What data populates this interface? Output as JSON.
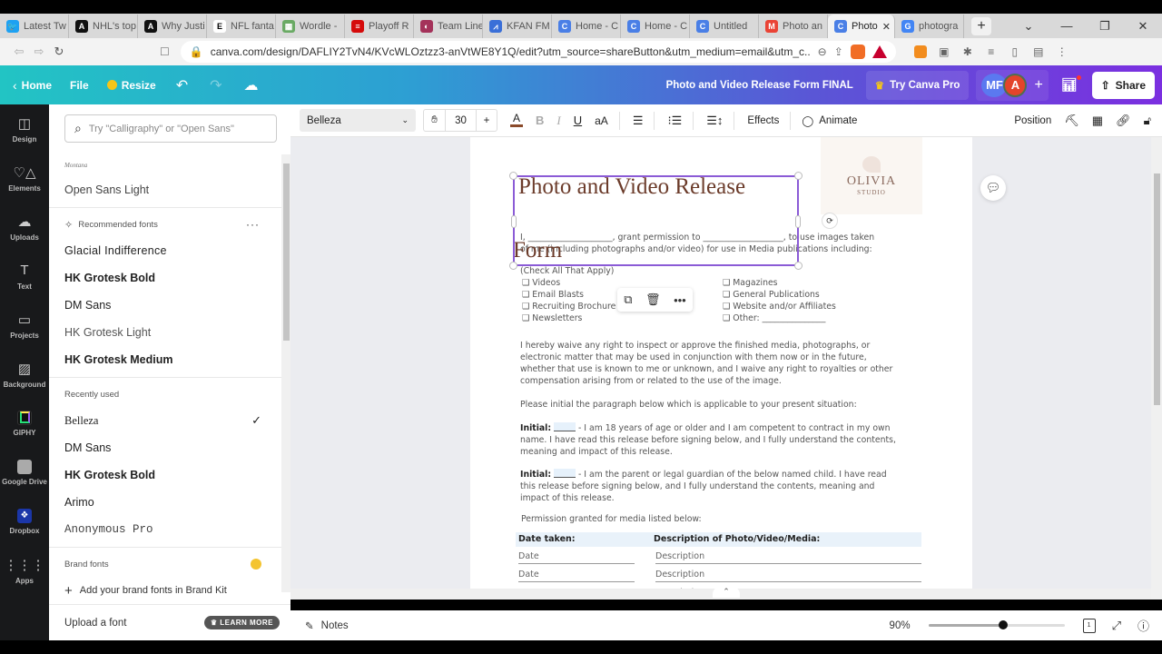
{
  "browser": {
    "tabs": [
      {
        "label": "Latest Tw",
        "icon": "twitter-icon",
        "color": "#1da1f2",
        "glyph": "🐦"
      },
      {
        "label": "NHL's top",
        "icon": "athletic-icon",
        "color": "#111111",
        "glyph": "A"
      },
      {
        "label": "Why Justi",
        "icon": "athletic-icon",
        "color": "#111111",
        "glyph": "A"
      },
      {
        "label": "NFL fanta",
        "icon": "espn-icon",
        "color": "#ffffff",
        "glyph": "E"
      },
      {
        "label": "Wordle -",
        "icon": "wordle-icon",
        "color": "#6aaa64",
        "glyph": "▦"
      },
      {
        "label": "Playoff R",
        "icon": "espn-red-icon",
        "color": "#d50a0a",
        "glyph": "≡"
      },
      {
        "label": "Team Line",
        "icon": "team-icon",
        "color": "#a4325a",
        "glyph": "◐"
      },
      {
        "label": "KFAN FM",
        "icon": "kfan-icon",
        "color": "#3a6fd8",
        "glyph": "⩘"
      },
      {
        "label": "Home - C",
        "icon": "canva-icon",
        "color": "#4a7fe6",
        "glyph": "C"
      },
      {
        "label": "Home - C",
        "icon": "canva-icon",
        "color": "#4a7fe6",
        "glyph": "C"
      },
      {
        "label": "Untitled",
        "icon": "canva-icon",
        "color": "#4a7fe6",
        "glyph": "C"
      },
      {
        "label": "Photo an",
        "icon": "gmail-icon",
        "color": "#ea4335",
        "glyph": "M"
      },
      {
        "label": "Photo",
        "icon": "canva-icon",
        "color": "#4a7fe6",
        "glyph": "C",
        "active": true
      },
      {
        "label": "photogra",
        "icon": "google-icon",
        "color": "#4285f4",
        "glyph": "G"
      }
    ],
    "url": "canva.com/design/DAFLIY2TvN4/KVcWLOztzz3-anVtWE8Y1Q/edit?utm_source=shareButton&utm_medium=email&utm_c..."
  },
  "header": {
    "home": "Home",
    "file": "File",
    "resize": "Resize",
    "doc_title": "Photo and Video Release Form FINAL",
    "try_pro": "Try Canva Pro",
    "avatar_mf": "MF",
    "avatar_a": "A",
    "share": "Share"
  },
  "rail": [
    {
      "label": "Design",
      "glyph": "◫"
    },
    {
      "label": "Elements",
      "glyph": "♡△"
    },
    {
      "label": "Uploads",
      "glyph": "☁"
    },
    {
      "label": "Text",
      "glyph": "T"
    },
    {
      "label": "Projects",
      "glyph": "▭"
    },
    {
      "label": "Background",
      "glyph": "▨"
    },
    {
      "label": "GIPHY",
      "glyph": ""
    },
    {
      "label": "Google Drive",
      "glyph": ""
    },
    {
      "label": "Dropbox",
      "glyph": "❖"
    },
    {
      "label": "Apps",
      "glyph": "⋮⋮⋮"
    }
  ],
  "panel": {
    "search_placeholder": "Try \"Calligraphy\" or \"Open Sans\"",
    "top_fonts": [
      "Montana",
      "Open Sans Light"
    ],
    "recommended_label": "Recommended fonts",
    "recommended": [
      "Glacial Indifference",
      "HK Grotesk Bold",
      "DM Sans",
      "HK Grotesk Light",
      "HK Grotesk Medium"
    ],
    "recent_label": "Recently used",
    "recent": [
      "Belleza",
      "DM Sans",
      "HK Grotesk Bold",
      "Arimo",
      "Anonymous Pro"
    ],
    "brand_label": "Brand fonts",
    "brand_add": "Add your brand fonts in Brand Kit",
    "upload": "Upload a font",
    "learn_more": "LEARN MORE"
  },
  "toolbar": {
    "font": "Belleza",
    "size": "30",
    "effects": "Effects",
    "animate": "Animate",
    "position": "Position"
  },
  "document": {
    "title_line1": "Photo and Video Release",
    "title_line2": "Form",
    "line1": "I, ____________________, grant permission to ___________________, to use images taken",
    "line2": "of me (including photographs and/or video) for use in Media publications including:",
    "check_all": "(Check All That Apply)",
    "options_left": [
      "❑ Videos",
      "❑ Email Blasts",
      "❑ Recruiting Brochure",
      "❑ Newsletters"
    ],
    "options_right": [
      "❑ Magazines",
      "❑ General Publications",
      "❑ Website and/or Affiliates",
      "❑ Other: _______________"
    ],
    "waiver": [
      "I hereby waive any right to inspect or approve the finished media, photographs, or",
      "electronic matter that may be used in conjunction with them now or in the future,",
      "whether that use is known to me or unknown, and I waive any right to royalties or other",
      "compensation arising from or related to the use of the image."
    ],
    "instruction": "Please initial the paragraph below which is applicable to your present situation:",
    "initial_label": "Initial:",
    "initial1": [
      " - I am 18 years of age or older and I am competent to contract in my own",
      "name. I have read this release before signing below, and I fully understand the contents,",
      "meaning and impact of this release."
    ],
    "initial2": [
      " - I am the parent or legal guardian of the below named child. I have read",
      "this release before signing below, and I fully understand the contents, meaning and",
      "impact of this release."
    ],
    "permission": "Permission granted for media listed below:",
    "col_date": "Date taken:",
    "col_desc": "Description of Photo/Video/Media:",
    "rows": [
      {
        "date": "Date",
        "desc": "Description"
      },
      {
        "date": "Date",
        "desc": "Description"
      },
      {
        "date": "Date",
        "desc": "Description"
      }
    ],
    "logo_name": "OLIVIA",
    "logo_sub": "STUDIO"
  },
  "footer": {
    "notes": "Notes",
    "zoom": "90%",
    "zoom_fraction": 0.55,
    "page_num": "1"
  }
}
